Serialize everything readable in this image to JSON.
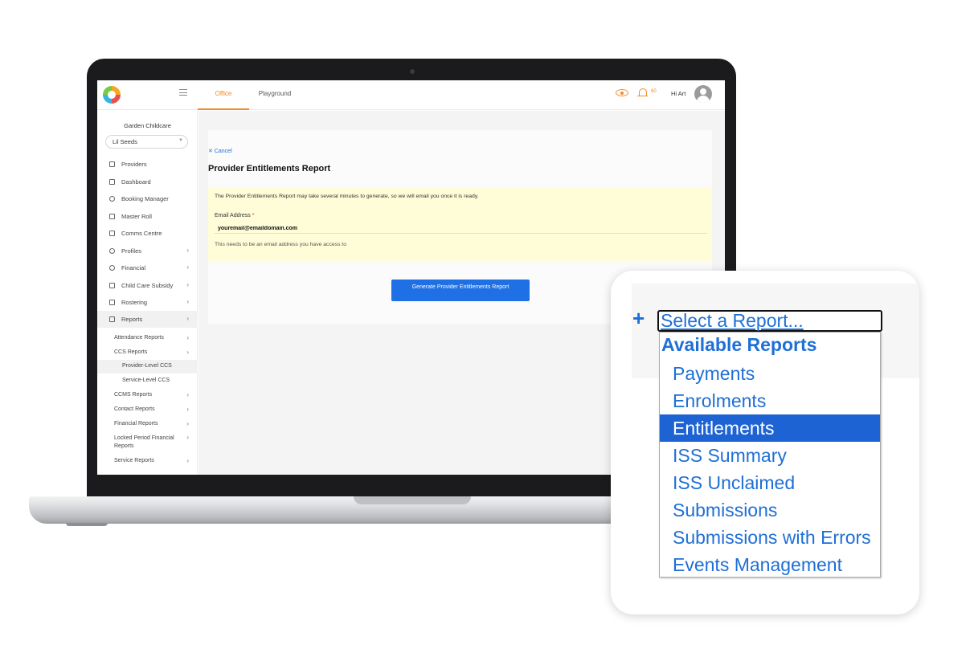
{
  "header": {
    "tabs": [
      {
        "label": "Office",
        "active": true
      },
      {
        "label": "Playground",
        "active": false
      }
    ],
    "notification_count": "60",
    "greeting": "Hi Art"
  },
  "sidebar": {
    "org_name": "Garden Childcare",
    "site_select_value": "Lil Seeds",
    "items": [
      {
        "label": "Providers",
        "icon": "building-icon"
      },
      {
        "label": "Dashboard",
        "icon": "grid-icon"
      },
      {
        "label": "Booking Manager",
        "icon": "refresh-icon"
      },
      {
        "label": "Master Roll",
        "icon": "calendar-icon"
      },
      {
        "label": "Comms Centre",
        "icon": "chat-icon"
      },
      {
        "label": "Profiles",
        "icon": "user-icon"
      },
      {
        "label": "Financial",
        "icon": "dollar-icon"
      },
      {
        "label": "Child Care Subsidy",
        "icon": "bank-icon"
      },
      {
        "label": "Rostering",
        "icon": "roster-icon"
      },
      {
        "label": "Reports",
        "icon": "report-icon"
      }
    ],
    "report_items": [
      "Attendance Reports",
      "CCS Reports",
      "Provider-Level CCS",
      "Service-Level CCS",
      "CCMS Reports",
      "Contact Reports",
      "Financial Reports",
      "Locked Period Financial Reports",
      "Service Reports"
    ]
  },
  "main": {
    "cancel_label": "Cancel",
    "title": "Provider Entitlements Report",
    "notice": "The Provider Entitlements Report may take several minutes to generate, so we will email you once it is ready.",
    "email_label": "Email Address",
    "email_value": "youremail@emaildomain.com",
    "email_hint": "This needs to be an email address you have access to",
    "generate_button": "Generate Provider Entitlements Report"
  },
  "callout": {
    "select_label": "Select a Report...",
    "group_label": "Available Reports",
    "options": [
      "Payments",
      "Enrolments",
      "Entitlements",
      "ISS Summary",
      "ISS Unclaimed",
      "Submissions",
      "Submissions with Errors",
      "Events Management"
    ],
    "selected_option": "Entitlements"
  },
  "colors": {
    "brand_orange": "#f08a24",
    "primary_blue": "#1f6fe5",
    "notice_yellow": "#fefdd8"
  }
}
